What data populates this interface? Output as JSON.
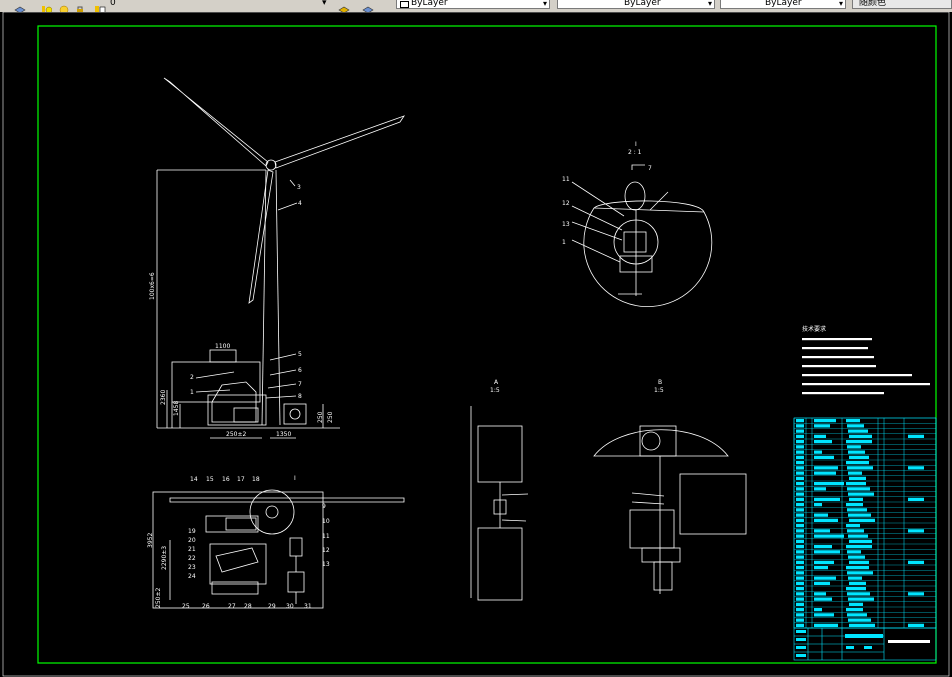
{
  "toolbar": {
    "layer_current": "0",
    "color_control": "ByLayer",
    "linetype_control": "ByLayer",
    "lineweight_control": "ByLayer",
    "plotstyle_control": "随颜色"
  },
  "colors": {
    "background": "#000000",
    "border": "#00ff00",
    "lines": "#ffffff",
    "title_block": "#00e5ff",
    "text_yellow": "#ffff00"
  },
  "drawing": {
    "dim_height": "100x6=6",
    "dim_top": "1100",
    "section_label": "I",
    "section_scale": "2 : 1",
    "view_label_a": "A",
    "view_label_b": "B",
    "scale_a": "1:5",
    "scale_b": "1:5",
    "dim_side": "3952",
    "dim_side_2": "2290±3",
    "base_dims": [
      "2360",
      "1458",
      "250±2",
      "1350",
      "250",
      "250",
      "250±2",
      "2390±3"
    ],
    "notes_title": "技术要求",
    "notes_count": 7,
    "balloons_top": [
      "2",
      "4",
      "3",
      "1"
    ],
    "balloons_right": [
      "5",
      "6",
      "7",
      "8"
    ],
    "balloons_plan_top": [
      "14",
      "15",
      "16",
      "17",
      "18"
    ],
    "balloons_plan_left": [
      "19",
      "20",
      "21",
      "22",
      "23",
      "24"
    ],
    "balloons_plan_bottom": [
      "25",
      "26",
      "27",
      "28",
      "29",
      "30",
      "31"
    ],
    "balloons_plan_right": [
      "9",
      "10",
      "11",
      "12",
      "13"
    ],
    "balloons_section": [
      "11",
      "12",
      "13",
      "1",
      "7"
    ]
  }
}
